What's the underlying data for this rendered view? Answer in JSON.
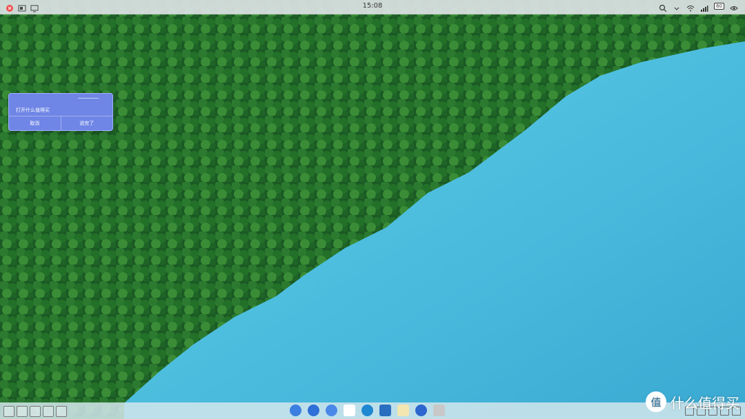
{
  "status_bar": {
    "time": "15:08",
    "battery": "60"
  },
  "dialog": {
    "message": "打开什么值得买",
    "cancel_label": "取消",
    "confirm_label": "说完了"
  },
  "watermark": {
    "logo_char": "值",
    "text": "什么值得买"
  },
  "colors": {
    "dialog_bg": "#6f86e6",
    "lake": "#4ec2e0",
    "forest": "#1f6b2c"
  }
}
